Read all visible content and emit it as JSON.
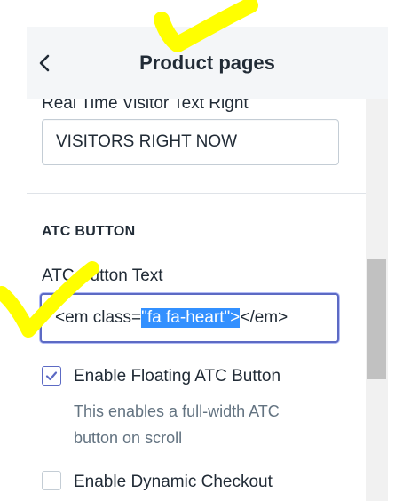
{
  "header": {
    "title": "Product pages"
  },
  "visitors_field": {
    "label": "Real Time Visitor Text Right",
    "value": "VISITORS RIGHT NOW"
  },
  "atc_section": {
    "heading": "ATC BUTTON",
    "text_label": "ATC Button Text",
    "text_value_before": "<em class=",
    "text_value_selected": "\"fa fa-heart\">",
    "text_value_after": "</em>"
  },
  "options": {
    "floating": {
      "label": "Enable Floating ATC Button",
      "checked": true,
      "help": "This enables a full-width ATC button on scroll"
    },
    "dynamic": {
      "label": "Enable Dynamic Checkout",
      "checked": false
    }
  },
  "colors": {
    "accent": "#5c6ac4",
    "selection": "#3390ff",
    "annotation": "#ffff00"
  },
  "icons": {
    "back": "chevron-left-icon",
    "check": "checkmark-icon"
  }
}
